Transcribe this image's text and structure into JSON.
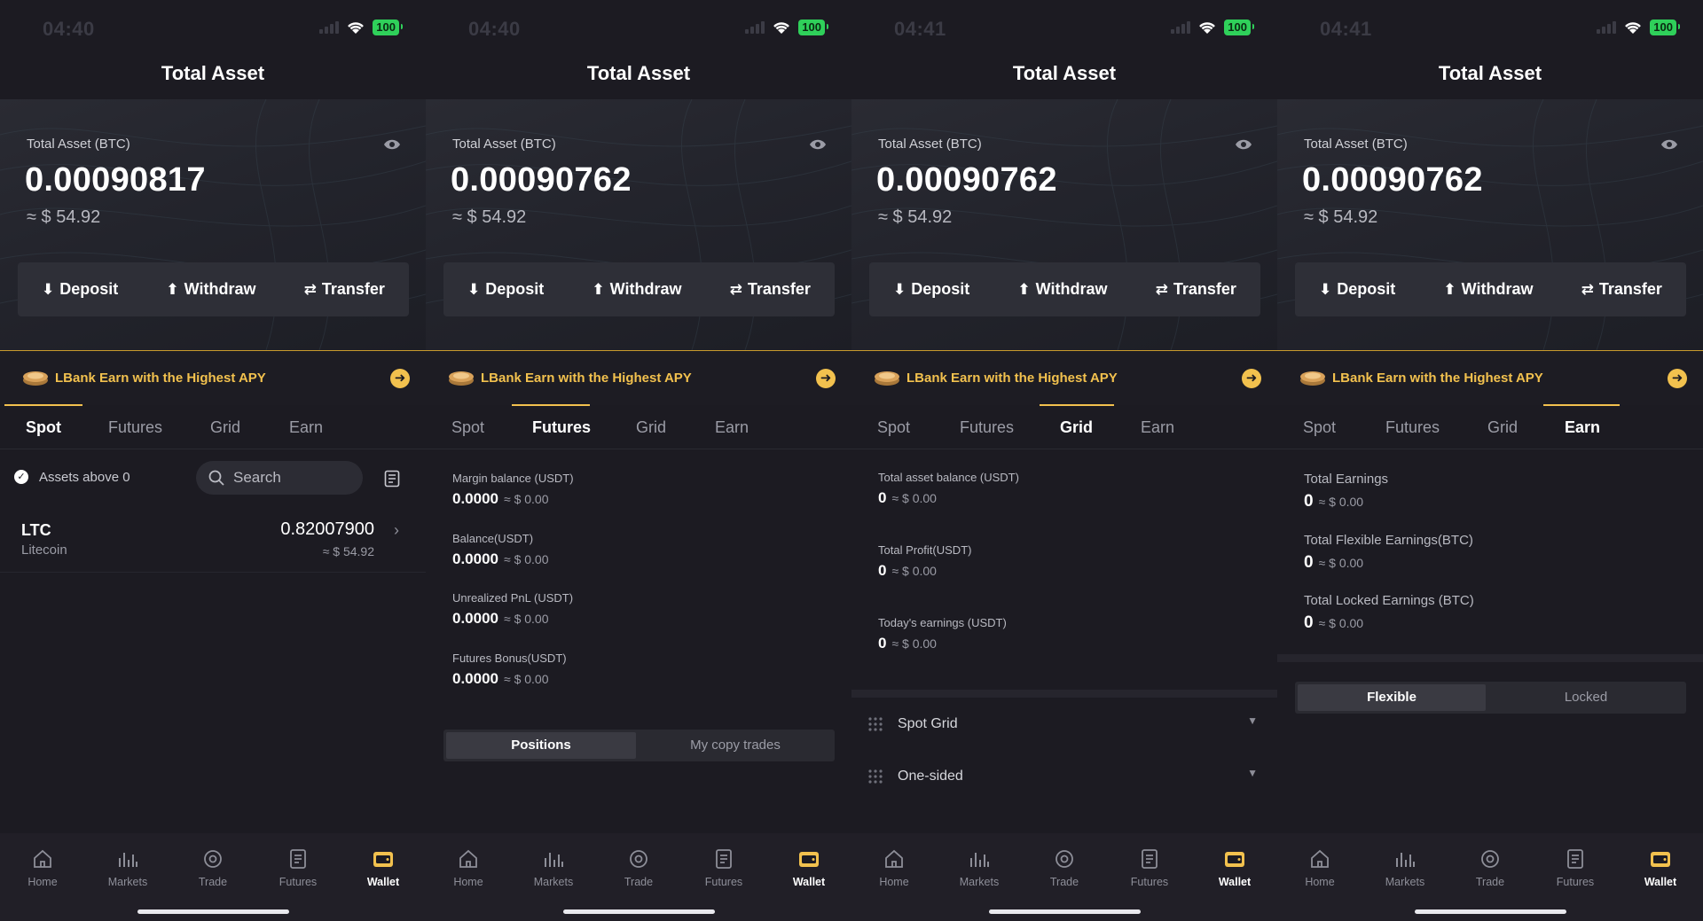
{
  "panels": [
    {
      "status_time": "04:40",
      "battery": "100",
      "title": "Total Asset",
      "hero": {
        "label": "Total Asset (BTC)",
        "value": "0.00090817",
        "usd": "≈ $ 54.92"
      },
      "actions": {
        "deposit": "Deposit",
        "withdraw": "Withdraw",
        "transfer": "Transfer"
      },
      "promo": "LBank Earn with the Highest APY",
      "tabs": [
        "Spot",
        "Futures",
        "Grid",
        "Earn"
      ],
      "active_tab": "Spot",
      "spot": {
        "filter_label": "Assets above 0",
        "search_placeholder": "Search",
        "assets": [
          {
            "symbol": "LTC",
            "name": "Litecoin",
            "amount": "0.82007900",
            "usd": "≈ $ 54.92"
          }
        ]
      }
    },
    {
      "status_time": "04:40",
      "battery": "100",
      "title": "Total Asset",
      "hero": {
        "label": "Total Asset (BTC)",
        "value": "0.00090762",
        "usd": "≈ $ 54.92"
      },
      "actions": {
        "deposit": "Deposit",
        "withdraw": "Withdraw",
        "transfer": "Transfer"
      },
      "promo": "LBank Earn with the Highest APY",
      "tabs": [
        "Spot",
        "Futures",
        "Grid",
        "Earn"
      ],
      "active_tab": "Futures",
      "futures": {
        "stats": [
          {
            "label": "Margin balance (USDT)",
            "value": "0.0000",
            "usd": "≈ $ 0.00"
          },
          {
            "label": "Balance(USDT)",
            "value": "0.0000",
            "usd": "≈ $ 0.00"
          },
          {
            "label": "Unrealized PnL (USDT)",
            "value": "0.0000",
            "usd": "≈ $ 0.00"
          },
          {
            "label": "Futures Bonus(USDT)",
            "value": "0.0000",
            "usd": "≈ $ 0.00"
          }
        ],
        "segment": [
          "Positions",
          "My copy trades"
        ]
      }
    },
    {
      "status_time": "04:41",
      "battery": "100",
      "title": "Total Asset",
      "hero": {
        "label": "Total Asset (BTC)",
        "value": "0.00090762",
        "usd": "≈ $ 54.92"
      },
      "actions": {
        "deposit": "Deposit",
        "withdraw": "Withdraw",
        "transfer": "Transfer"
      },
      "promo": "LBank Earn with the Highest APY",
      "tabs": [
        "Spot",
        "Futures",
        "Grid",
        "Earn"
      ],
      "active_tab": "Grid",
      "grid": {
        "stats": [
          {
            "label": "Total asset balance (USDT)",
            "value": "0",
            "usd": "≈ $ 0.00"
          },
          {
            "label": "Total Profit(USDT)",
            "value": "0",
            "usd": "≈ $ 0.00"
          },
          {
            "label": "Today's earnings (USDT)",
            "value": "0",
            "usd": "≈ $ 0.00"
          }
        ],
        "rows": [
          "Spot Grid",
          "One-sided"
        ]
      }
    },
    {
      "status_time": "04:41",
      "battery": "100",
      "title": "Total Asset",
      "hero": {
        "label": "Total Asset (BTC)",
        "value": "0.00090762",
        "usd": "≈ $ 54.92"
      },
      "actions": {
        "deposit": "Deposit",
        "withdraw": "Withdraw",
        "transfer": "Transfer"
      },
      "promo": "LBank Earn with the Highest APY",
      "tabs": [
        "Spot",
        "Futures",
        "Grid",
        "Earn"
      ],
      "active_tab": "Earn",
      "earn": {
        "stats": [
          {
            "label": "Total Earnings",
            "value": "0",
            "usd": "≈ $ 0.00"
          },
          {
            "label": "Total Flexible Earnings(BTC)",
            "value": "0",
            "usd": "≈ $ 0.00"
          },
          {
            "label": "Total Locked Earnings (BTC)",
            "value": "0",
            "usd": "≈ $ 0.00"
          }
        ],
        "segment": [
          "Flexible",
          "Locked"
        ]
      }
    }
  ],
  "nav": [
    "Home",
    "Markets",
    "Trade",
    "Futures",
    "Wallet"
  ],
  "nav_active": "Wallet",
  "colors": {
    "accent": "#f2c14e",
    "background": "#1c1b22",
    "battery": "#2fd05a"
  }
}
